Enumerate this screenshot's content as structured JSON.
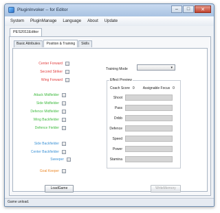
{
  "window": {
    "title": "PluginInvoker -- for Editor",
    "minimize": "–",
    "maximize": "□",
    "close": "✕"
  },
  "menu": [
    "System",
    "PluginManage",
    "Language",
    "About",
    "Update"
  ],
  "document_tab": "PES2011Editor",
  "tabs": [
    {
      "label": "Basic Attributes",
      "active": false
    },
    {
      "label": "Position & Training",
      "active": true
    },
    {
      "label": "Skills",
      "active": false
    }
  ],
  "positions": [
    {
      "label": "Center Forward",
      "color": "#e03c3c",
      "checked": false
    },
    {
      "label": "Second Striker",
      "color": "#e03c3c",
      "checked": false
    },
    {
      "label": "Wing Forward",
      "color": "#e03c3c",
      "checked": false
    },
    {
      "label": "Attack Midfielder",
      "color": "#3fba3f",
      "checked": false
    },
    {
      "label": "Side Midfielder",
      "color": "#3fba3f",
      "checked": false
    },
    {
      "label": "Defence Midfielder",
      "color": "#3fba3f",
      "checked": false
    },
    {
      "label": "Wing Backfielder",
      "color": "#3fba3f",
      "checked": false
    },
    {
      "label": "Defence Fielder",
      "color": "#3fba3f",
      "checked": false
    },
    {
      "label": "Side Backfielder",
      "color": "#3e93d6",
      "checked": false
    },
    {
      "label": "Center Backfielder",
      "color": "#3e93d6",
      "checked": false
    },
    {
      "label": "Sweeper",
      "color": "#3e93d6",
      "checked": false
    },
    {
      "label": "Goal Keeper",
      "color": "#ec8a2c",
      "checked": false
    }
  ],
  "training": {
    "mode_label": "Training Mode",
    "mode_value": "",
    "effect_title": "Effect Preview",
    "coach_score_label": "Coach Score",
    "coach_score_value": "0",
    "focus_label": "Assignable Focus",
    "focus_value": "0",
    "stats": [
      "Shoot",
      "Pass",
      "Dribb",
      "Defence",
      "Speed",
      "Power",
      "Stamina"
    ]
  },
  "buttons": {
    "load_game": "LoadGame",
    "write_memory": "WriteMemory"
  },
  "status": "Game unload."
}
